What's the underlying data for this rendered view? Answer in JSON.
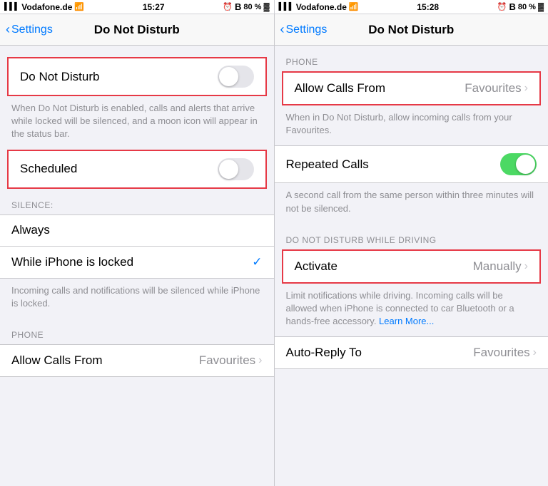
{
  "statusBars": [
    {
      "carrier": "Vodafone.de",
      "time": "15:27",
      "battery": "80 %",
      "alarm": true,
      "bluetooth": true
    },
    {
      "carrier": "Vodafone.de",
      "time": "15:28",
      "battery": "80 %",
      "alarm": true,
      "bluetooth": true
    }
  ],
  "screens": [
    {
      "nav": {
        "back": "Settings",
        "title": "Do Not Disturb"
      },
      "sections": [
        {
          "type": "toggle-row",
          "label": "Do Not Disturb",
          "value": false,
          "highlighted": true,
          "description": "When Do Not Disturb is enabled, calls and alerts that arrive while locked will be silenced, and a moon icon will appear in the status bar."
        },
        {
          "type": "toggle-row",
          "label": "Scheduled",
          "value": false,
          "highlighted": true
        },
        {
          "type": "section-header",
          "text": "SILENCE:"
        },
        {
          "type": "option-rows",
          "rows": [
            {
              "label": "Always",
              "selected": false
            },
            {
              "label": "While iPhone is locked",
              "selected": true
            }
          ]
        },
        {
          "type": "description",
          "text": "Incoming calls and notifications will be silenced while iPhone is locked."
        },
        {
          "type": "section-header",
          "text": "PHONE"
        },
        {
          "type": "nav-row",
          "label": "Allow Calls From",
          "value": "Favourites"
        }
      ]
    },
    {
      "nav": {
        "back": "Settings",
        "title": "Do Not Disturb"
      },
      "sections": [
        {
          "type": "section-header",
          "text": "PHONE"
        },
        {
          "type": "nav-row",
          "label": "Allow Calls From",
          "value": "Favourites",
          "highlighted": true
        },
        {
          "type": "description",
          "text": "When in Do Not Disturb, allow incoming calls from your Favourites."
        },
        {
          "type": "toggle-row-plain",
          "label": "Repeated Calls",
          "value": true
        },
        {
          "type": "description",
          "text": "A second call from the same person within three minutes will not be silenced."
        },
        {
          "type": "section-header",
          "text": "DO NOT DISTURB WHILE DRIVING"
        },
        {
          "type": "nav-rows-highlighted",
          "rows": [
            {
              "label": "Activate",
              "value": "Manually"
            }
          ],
          "highlighted": true
        },
        {
          "type": "description-link",
          "text": "Limit notifications while driving. Incoming calls will be allowed when iPhone is connected to car Bluetooth or a hands-free accessory.",
          "linkText": "Learn More...",
          "linkUrl": "#"
        },
        {
          "type": "nav-row",
          "label": "Auto-Reply To",
          "value": "Favourites"
        }
      ]
    }
  ],
  "icons": {
    "signal": "▌▌▌",
    "wifi": "WiFi",
    "alarm": "⏰",
    "bluetooth": "B",
    "battery": "🔋"
  }
}
